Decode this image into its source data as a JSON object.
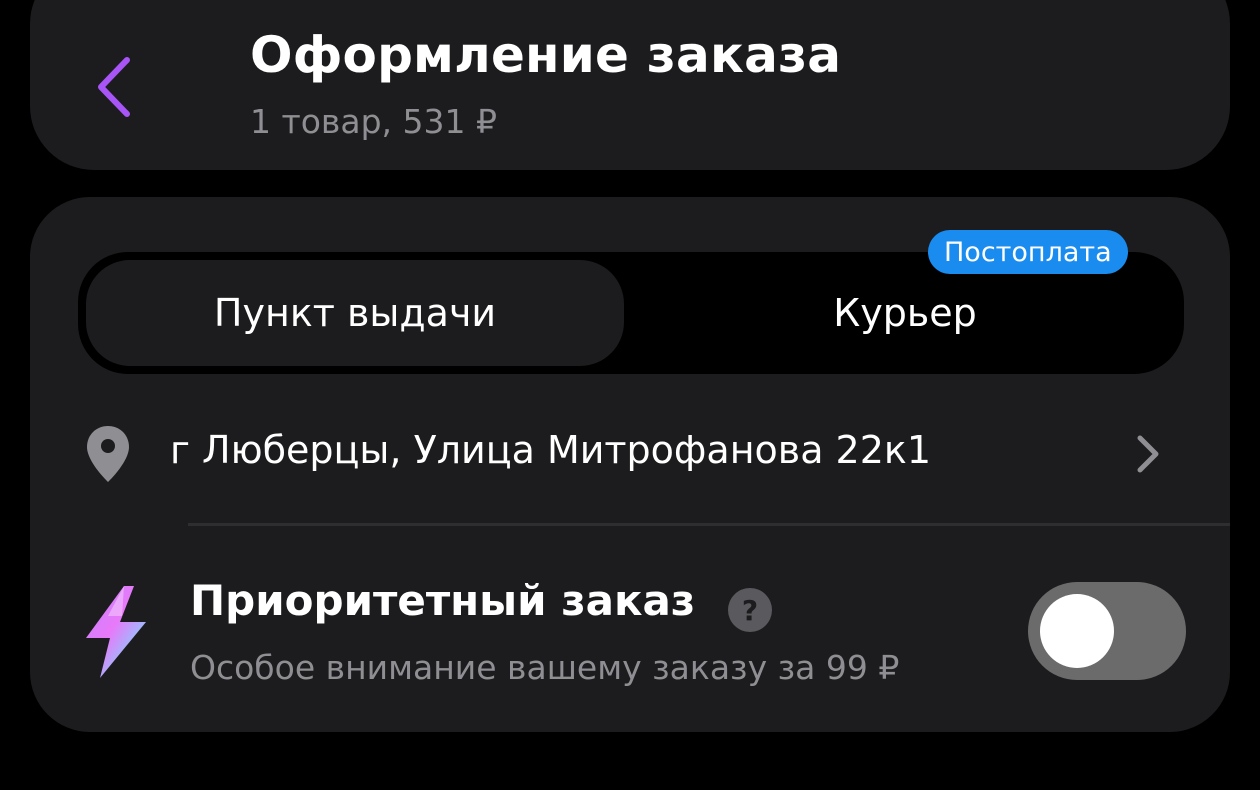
{
  "header": {
    "title": "Оформление заказа",
    "subtitle": "1 товар, 531 ₽"
  },
  "delivery": {
    "tabs": [
      {
        "label": "Пункт выдачи",
        "selected": true
      },
      {
        "label": "Курьер",
        "selected": false,
        "badge": "Постоплата"
      }
    ],
    "address": "г Люберцы, Улица Митрофанова 22к1"
  },
  "priority": {
    "title": "Приоритетный заказ",
    "help_glyph": "?",
    "description": "Особое внимание вашему заказу за 99 ₽",
    "enabled": false
  },
  "icons": {
    "back": "chevron-left-icon",
    "location": "location-pin-icon",
    "address_arrow": "chevron-right-icon",
    "priority": "lightning-bolt-icon",
    "help": "question-mark-icon"
  },
  "colors": {
    "accent": "#a855f7",
    "badge": "#1a8cf0",
    "card": "#1c1c1e",
    "background": "#000000",
    "secondary_text": "#8e8e93",
    "toggle_off": "#6b6b6b"
  }
}
